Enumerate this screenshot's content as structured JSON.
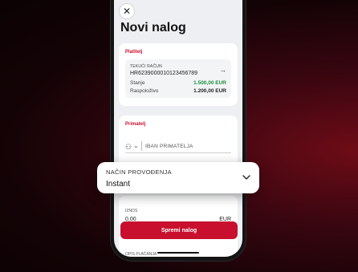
{
  "screen": {
    "title": "Novi nalog",
    "close_icon": "close-icon"
  },
  "payer": {
    "section_label": "Platitelj",
    "account_type": "TEKUĆI RAČUN",
    "account_number": "HR6239000010123456789",
    "balance_label": "Stanje",
    "balance_value": "1.500,00 EUR",
    "available_label": "Raspoloživo",
    "available_value": "1.200,00 EUR"
  },
  "payee": {
    "section_label": "Primatelj",
    "iban_placeholder": "IBAN PRIMATELJA"
  },
  "amount": {
    "label": "IZNOS",
    "value": "0,00",
    "currency": "EUR"
  },
  "actions": {
    "save_label": "Spremi nalog"
  },
  "description": {
    "label": "OPIS PLAĆANJA"
  },
  "execution_method": {
    "label": "NAČIN PROVOĐENJA",
    "value": "Instant"
  },
  "colors": {
    "accent": "#c8102e",
    "balance_green": "#1a8f3c"
  }
}
